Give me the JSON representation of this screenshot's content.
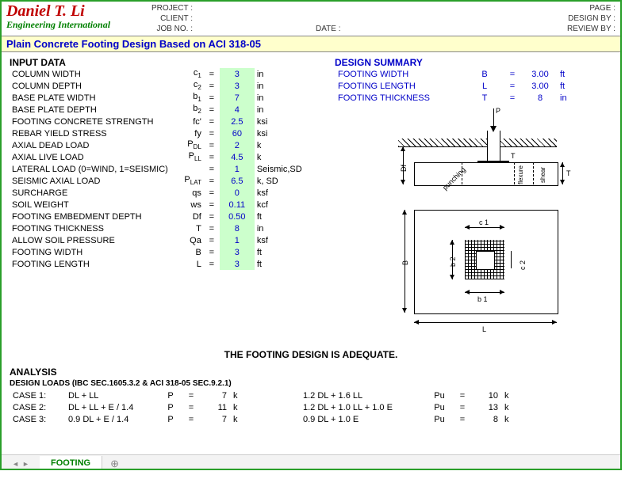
{
  "header": {
    "logo_name": "Daniel T. Li",
    "logo_sub": "Engineering International",
    "project_lbl": "PROJECT :",
    "client_lbl": "CLIENT :",
    "jobno_lbl": "JOB NO. :",
    "date_lbl": "DATE :",
    "page_lbl": "PAGE :",
    "designby_lbl": "DESIGN BY :",
    "reviewby_lbl": "REVIEW BY :"
  },
  "title": "Plain Concrete Footing Design Based on ACI 318-05",
  "input_h": "INPUT DATA",
  "sum_h": "DESIGN SUMMARY",
  "inputs": [
    {
      "d": "COLUMN WIDTH",
      "s": "c",
      "sub": "1",
      "v": "3",
      "u": "in"
    },
    {
      "d": "COLUMN DEPTH",
      "s": "c",
      "sub": "2",
      "v": "3",
      "u": "in"
    },
    {
      "d": "BASE PLATE WIDTH",
      "s": "b",
      "sub": "1",
      "v": "7",
      "u": "in"
    },
    {
      "d": "BASE PLATE DEPTH",
      "s": "b",
      "sub": "2",
      "v": "4",
      "u": "in"
    },
    {
      "d": "FOOTING CONCRETE STRENGTH",
      "s": "fc'",
      "sub": "",
      "v": "2.5",
      "u": "ksi"
    },
    {
      "d": "REBAR YIELD STRESS",
      "s": "fy",
      "sub": "",
      "v": "60",
      "u": "ksi"
    },
    {
      "d": "AXIAL DEAD LOAD",
      "s": "P",
      "sub": "DL",
      "v": "2",
      "u": "k"
    },
    {
      "d": "AXIAL LIVE LOAD",
      "s": "P",
      "sub": "LL",
      "v": "4.5",
      "u": "k"
    },
    {
      "d": "LATERAL LOAD (0=WIND, 1=SEISMIC)",
      "s": "",
      "sub": "",
      "v": "1",
      "u": "Seismic,SD"
    },
    {
      "d": "SEISMIC AXIAL LOAD",
      "s": "P",
      "sub": "LAT",
      "v": "6.5",
      "u": "k, SD"
    },
    {
      "d": "SURCHARGE",
      "s": "qs",
      "sub": "",
      "v": "0",
      "u": "ksf"
    },
    {
      "d": "SOIL WEIGHT",
      "s": "ws",
      "sub": "",
      "v": "0.11",
      "u": "kcf"
    },
    {
      "d": "FOOTING EMBEDMENT DEPTH",
      "s": "Df",
      "sub": "",
      "v": "0.50",
      "u": "ft"
    },
    {
      "d": "FOOTING THICKNESS",
      "s": "T",
      "sub": "",
      "v": "8",
      "u": "in"
    },
    {
      "d": "ALLOW SOIL PRESSURE",
      "s": "Qa",
      "sub": "",
      "v": "1",
      "u": "ksf"
    },
    {
      "d": "FOOTING WIDTH",
      "s": "B",
      "sub": "",
      "v": "3",
      "u": "ft"
    },
    {
      "d": "FOOTING LENGTH",
      "s": "L",
      "sub": "",
      "v": "3",
      "u": "ft"
    }
  ],
  "summary": [
    {
      "d": "FOOTING WIDTH",
      "s": "B",
      "v": "3.00",
      "u": "ft"
    },
    {
      "d": "FOOTING LENGTH",
      "s": "L",
      "v": "3.00",
      "u": "ft"
    },
    {
      "d": "FOOTING THICKNESS",
      "s": "T",
      "v": "8",
      "u": "in"
    }
  ],
  "adequate": "THE FOOTING DESIGN IS ADEQUATE.",
  "analysis_h": "ANALYSIS",
  "loads_h": "DESIGN  LOADS  (IBC SEC.1605.3.2 & ACI 318-05 SEC.9.2.1)",
  "cases": [
    {
      "n": "CASE 1:",
      "svc": "DL + LL",
      "P": "7",
      "fac": "1.2 DL + 1.6 LL",
      "Pu": "10"
    },
    {
      "n": "CASE 2:",
      "svc": "DL + LL + E / 1.4",
      "P": "11",
      "fac": "1.2 DL + 1.0 LL + 1.0 E",
      "Pu": "13"
    },
    {
      "n": "CASE 3:",
      "svc": "0.9 DL + E / 1.4",
      "P": "7",
      "fac": "0.9 DL + 1.0 E",
      "Pu": "8"
    }
  ],
  "diag": {
    "P": "P",
    "T": "T",
    "Df": "Df",
    "punch": "punching",
    "flex": "flexure",
    "shear": "shear",
    "c1": "c 1",
    "c2": "c 2",
    "b1": "b 1",
    "b2": "b 2",
    "B": "B",
    "L": "L"
  },
  "tab": "FOOTING",
  "unit_k": "k"
}
